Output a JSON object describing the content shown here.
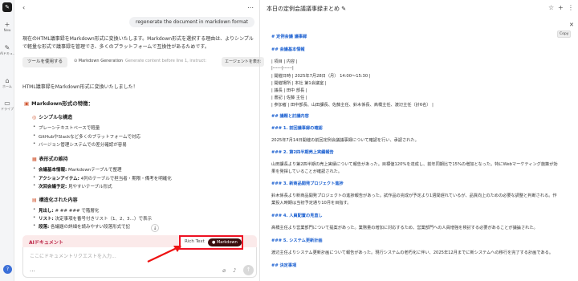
{
  "rail": {
    "logo": "✎",
    "items": [
      {
        "icon": "+",
        "label": "New"
      },
      {
        "icon": "✎",
        "label": "AIドキュ…"
      },
      {
        "icon": "⌂",
        "label": "ホーム"
      },
      {
        "icon": "▭",
        "label": "ドライブ"
      }
    ]
  },
  "chat": {
    "user_message": "regenerate the document in markdown format",
    "intro": "現在のHTML議事録をMarkdown形式に変換いたします。Markdown形式を選択する理由は、よりシンプルで軽量な形式で議事録を管理でき、多くのプラットフォームで互換性があるためです。",
    "tool": {
      "button": "ツールを使用する",
      "name": "Markdown Generation",
      "desc": "Generate content before line 1, instruct:",
      "agent": "エージェントを表示"
    },
    "done_message": "HTML議事録をMarkdown形式に変換いたしました！",
    "features_title": "Markdown形式の特徴：",
    "sections": [
      {
        "title": "シンプルな構造",
        "items": [
          {
            "bold": "",
            "text": "プレーンテキストベースで軽量"
          },
          {
            "bold": "",
            "text": "GitHubやSlackなど多くのプラットフォームで対応"
          },
          {
            "bold": "",
            "text": "バージョン管理システムでの差分確認が容易"
          }
        ]
      },
      {
        "title": "表形式の維持",
        "items": [
          {
            "bold": "会議基本情報:",
            "text": " Markdownテーブルで整理"
          },
          {
            "bold": "アクションアイテム:",
            "text": " 4列のテーブルで担当者・期限・備考を明確化"
          },
          {
            "bold": "次回会議予定:",
            "text": " 見やすいテーブル形式"
          }
        ]
      },
      {
        "title": "構造化された内容",
        "items": [
          {
            "bold": "見出し:",
            "text": " # ## ### で階層化"
          },
          {
            "bold": "リスト:",
            "text": " 決定事項を番号付きリスト（1、2、3…）で表示"
          },
          {
            "bold": "段落:",
            "text": " 各議題の詳細を読みやすい段落形式で記"
          }
        ]
      }
    ],
    "scroll_down": "↓",
    "doc_label": "AIドキュメント",
    "input_placeholder": "ここにドキュメントリクエストを入力...",
    "more": "···",
    "mode": {
      "rich": "Rich Text",
      "markdown": "Markdown"
    },
    "send": "↑"
  },
  "doc": {
    "title": "本日の定例会議議事録まとめ",
    "close": "✕",
    "copy": "Copy",
    "lines": [
      {
        "t": "# 定例会議 議事録",
        "h": true
      },
      {
        "t": "## 会議基本情報",
        "h": true
      },
      {
        "t": "| 項目 | 内容 |",
        "h": false
      },
      {
        "t": "|------|------|",
        "h": false
      },
      {
        "t": "| 開催日時 | 2025年7月28日（月） 14:00〜15:30 |",
        "h": false
      },
      {
        "t": "| 開催場所 | 本社 第1会議室 |",
        "h": false
      },
      {
        "t": "| 議長 | 田中 部長 |",
        "h": false
      },
      {
        "t": "| 書記 | 佐藤 主任 |",
        "h": false
      },
      {
        "t": "| 参加者 | 田中部長、山田課長、佐藤主任、鈴木係長、高橋主任、渡辺主任（計6名） |",
        "h": false
      },
      {
        "t": "## 議題と討議内容",
        "h": true
      },
      {
        "t": "### 1. 前回議事録の確認",
        "h": true
      },
      {
        "t": "2025年7月14日開催の前回定例会議議事録について確認を行い、承認された。",
        "h": false
      },
      {
        "t": "### 2. 第2四半期売上実績報告",
        "h": true
      },
      {
        "t": "山田課長より第2四半期の売上実績について報告があった。目標値120%を達成し、前年同期比で15%の増加となった。特にWebマーケティング施策が効",
        "h": false
      },
      {
        "t": "果を発揮していることが確認された。",
        "h": false
      },
      {
        "t": "### 3. 新商品開発プロジェクト進捗",
        "h": true
      },
      {
        "t": "鈴木係長より新商品開発プロジェクトの進捗報告があった。試作品の完成が予定より1週間遅れているが、品質向上のための必要な調整と判断される。作",
        "h": false
      },
      {
        "t": "業投入時期は当初予定通り10月を目指す。",
        "h": false
      },
      {
        "t": "### 4. 人員配置の見直し",
        "h": true
      },
      {
        "t": "高橋主任より営業部門について提案があった。業務量の増加に対応するため、営業部門への人員増強を検討する必要があることが議論された。",
        "h": false
      },
      {
        "t": "### 5. システム更新計画",
        "h": true
      },
      {
        "t": "渡辺主任よりシステム更新計画について報告があった。現行システムの老朽化に伴い、2025年12月までに新システムへの移行を完了する計画である。",
        "h": false
      },
      {
        "t": "## 決定事項",
        "h": true
      }
    ]
  }
}
